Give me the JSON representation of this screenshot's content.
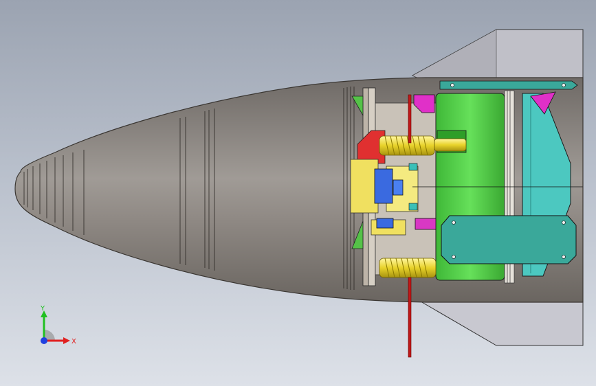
{
  "triad": {
    "x_label": "X",
    "y_label": "Y",
    "x_color": "#e02020",
    "y_color": "#20c020",
    "z_color": "#2040e0"
  },
  "colors": {
    "background_top": "#9ba3b1",
    "background_bottom": "#dde1e8",
    "nose_shell": "#8a8580",
    "green_body": "#55d24a",
    "cyan_body": "#4cc8c0",
    "teal_plate": "#3aa89a",
    "spring": "#e8d22a",
    "magenta_part": "#e030c8",
    "red_rod": "#c01818",
    "blue_block": "#3a6ae0",
    "yellow_block": "#f0e060",
    "red_block": "#e03030",
    "gray_fin": "#b8b8c0"
  }
}
